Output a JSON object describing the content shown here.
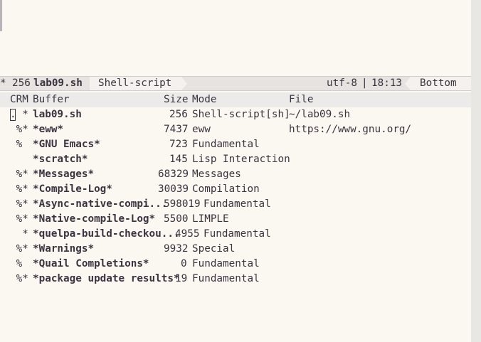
{
  "modeline": {
    "status": "*",
    "size": "256",
    "buffer_name": "lab09.sh",
    "mode": "Shell-script",
    "encoding": "utf-8",
    "separator": "|",
    "time": "18:13",
    "position": "Bottom"
  },
  "table": {
    "headers": {
      "crm": "CRM",
      "buffer": "Buffer",
      "size": "Size",
      "mode": "Mode",
      "file": "File"
    },
    "rows": [
      {
        "flags": ". *",
        "name": "lab09.sh",
        "size": "256",
        "mode": "Shell-script[sh]",
        "file": "~/lab09.sh"
      },
      {
        "flags": " %*",
        "name": "*eww*",
        "size": "7437",
        "mode": "eww",
        "file": "https://www.gnu.org/"
      },
      {
        "flags": " % ",
        "name": "*GNU Emacs*",
        "size": "723",
        "mode": "Fundamental",
        "file": ""
      },
      {
        "flags": "   ",
        "name": "*scratch*",
        "size": "145",
        "mode": "Lisp Interaction",
        "file": ""
      },
      {
        "flags": " %*",
        "name": "*Messages*",
        "size": "68329",
        "mode": "Messages",
        "file": ""
      },
      {
        "flags": " %*",
        "name": "*Compile-Log*",
        "size": "30039",
        "mode": "Compilation",
        "file": ""
      },
      {
        "flags": " %*",
        "name": "*Async-native-compi...",
        "size": "598019",
        "mode": "Fundamental",
        "file": ""
      },
      {
        "flags": " %*",
        "name": "*Native-compile-Log*",
        "size": "5500",
        "mode": "LIMPLE",
        "file": ""
      },
      {
        "flags": "  *",
        "name": "*quelpa-build-checkou...",
        "size": "4955",
        "mode": "Fundamental",
        "file": ""
      },
      {
        "flags": " %*",
        "name": "*Warnings*",
        "size": "9932",
        "mode": "Special",
        "file": ""
      },
      {
        "flags": " % ",
        "name": "*Quail Completions*",
        "size": "0",
        "mode": "Fundamental",
        "file": ""
      },
      {
        "flags": " %*",
        "name": "*package update results*",
        "size": "19",
        "mode": "Fundamental",
        "file": ""
      }
    ]
  }
}
